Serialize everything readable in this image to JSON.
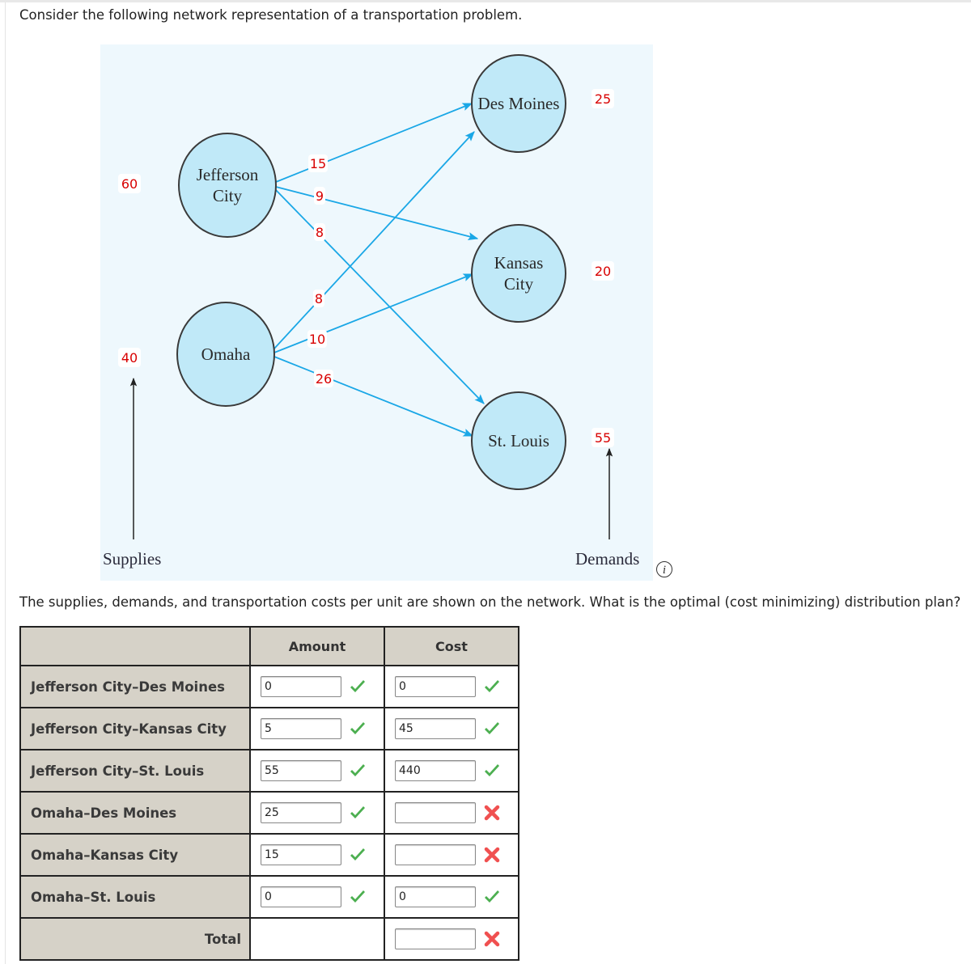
{
  "intro": "Consider the following network representation of a transportation problem.",
  "network": {
    "origins": [
      {
        "name_lines": [
          "Jefferson",
          "City"
        ],
        "supply": "60"
      },
      {
        "name_lines": [
          "Omaha"
        ],
        "supply": "40"
      }
    ],
    "destinations": [
      {
        "name_lines": [
          "Des Moines"
        ],
        "demand": "25"
      },
      {
        "name_lines": [
          "Kansas",
          "City"
        ],
        "demand": "20"
      },
      {
        "name_lines": [
          "St. Louis"
        ],
        "demand": "55"
      }
    ],
    "arcs": [
      {
        "from": 0,
        "to": 0,
        "cost": "15"
      },
      {
        "from": 0,
        "to": 1,
        "cost": "9"
      },
      {
        "from": 0,
        "to": 2,
        "cost": "8"
      },
      {
        "from": 1,
        "to": 0,
        "cost": "8"
      },
      {
        "from": 1,
        "to": 1,
        "cost": "10"
      },
      {
        "from": 1,
        "to": 2,
        "cost": "26"
      }
    ],
    "supplies_label": "Supplies",
    "demands_label": "Demands",
    "node_fill": "#c0e9f8",
    "arc_color": "#1aa7e6",
    "label_color": "#d80000"
  },
  "info_icon": "i",
  "question": "The supplies, demands, and transportation costs per unit are shown on the network. What is the optimal (cost minimizing) distribution plan?",
  "table": {
    "headers": [
      "",
      "Amount",
      "Cost"
    ],
    "rows": [
      {
        "label": "Jefferson City–Des Moines",
        "amount": "0",
        "amount_status": "correct",
        "cost": "0",
        "cost_status": "correct"
      },
      {
        "label": "Jefferson City–Kansas City",
        "amount": "5",
        "amount_status": "correct",
        "cost": "45",
        "cost_status": "correct"
      },
      {
        "label": "Jefferson City–St. Louis",
        "amount": "55",
        "amount_status": "correct",
        "cost": "440",
        "cost_status": "correct"
      },
      {
        "label": "Omaha–Des Moines",
        "amount": "25",
        "amount_status": "correct",
        "cost": "",
        "cost_status": "incorrect"
      },
      {
        "label": "Omaha–Kansas City",
        "amount": "15",
        "amount_status": "correct",
        "cost": "",
        "cost_status": "incorrect"
      },
      {
        "label": "Omaha–St. Louis",
        "amount": "0",
        "amount_status": "correct",
        "cost": "0",
        "cost_status": "correct"
      }
    ],
    "total": {
      "label": "Total",
      "cost": "",
      "cost_status": "incorrect"
    }
  },
  "status_colors": {
    "correct": "#4caf50",
    "incorrect": "#f05050"
  }
}
